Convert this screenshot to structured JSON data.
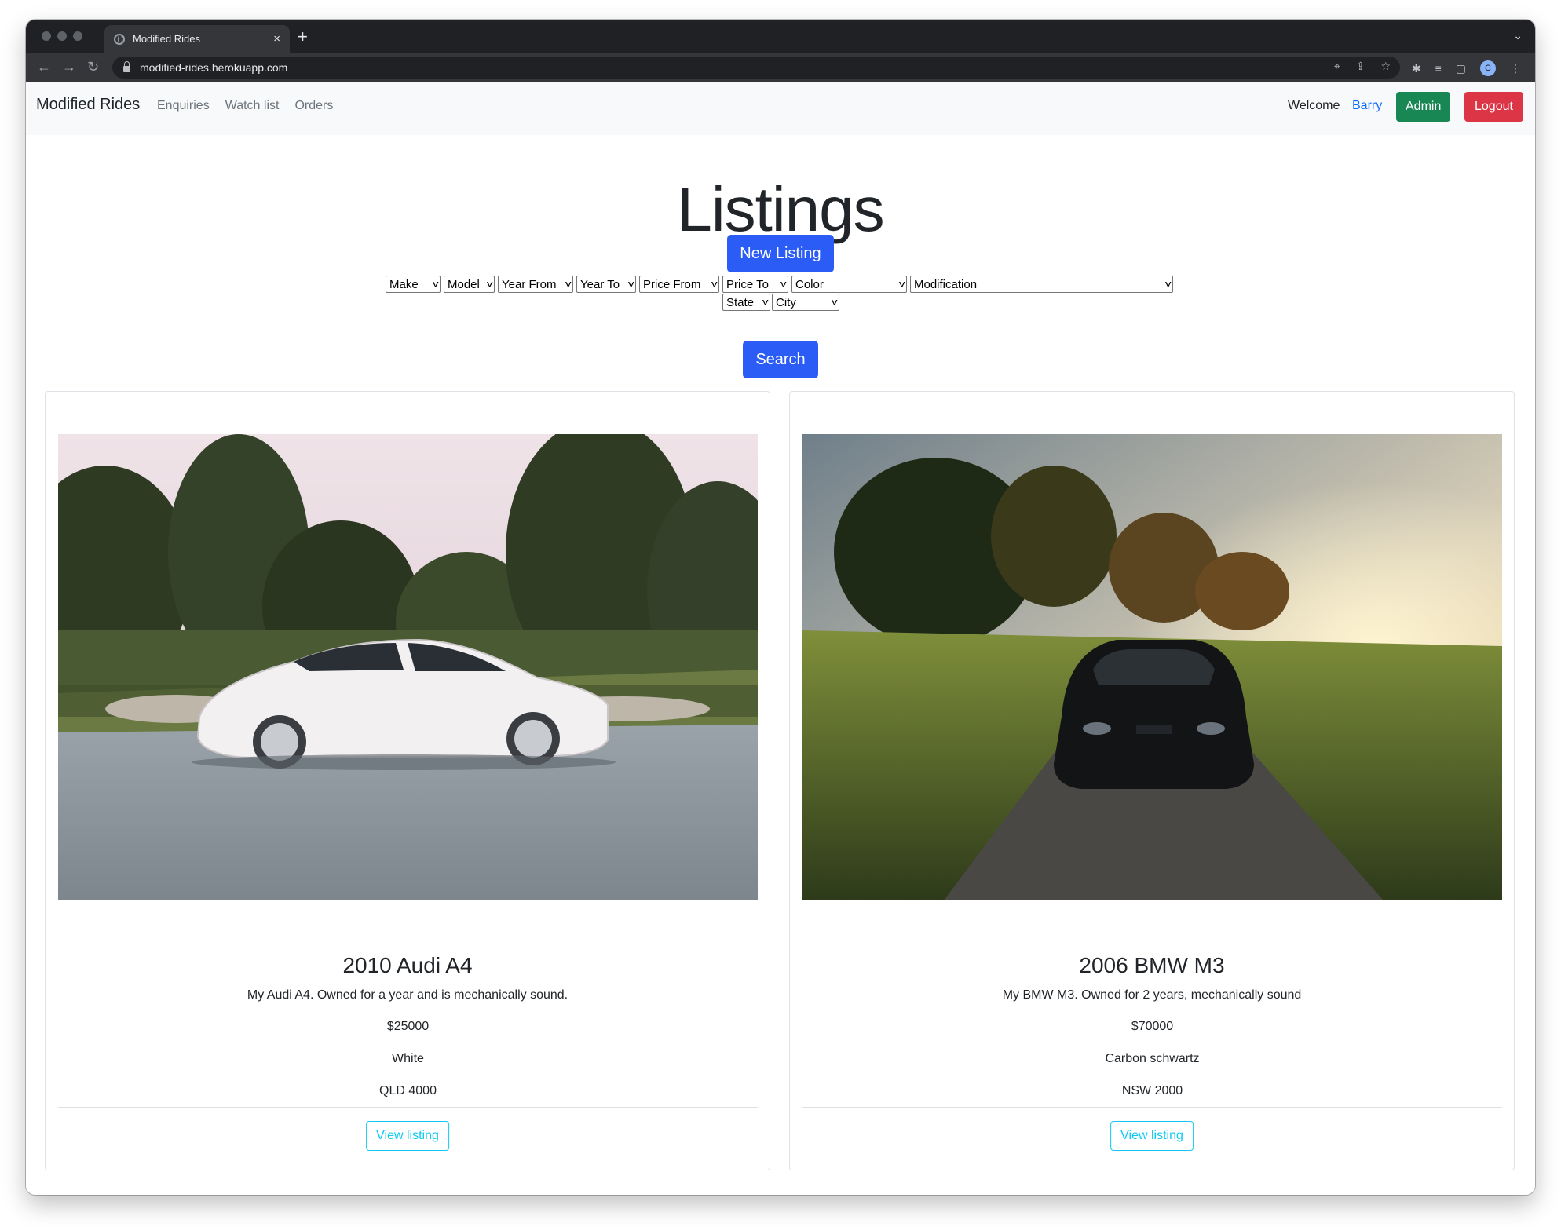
{
  "browser": {
    "tab_title": "Modified Rides",
    "tab_close": "×",
    "new_tab": "+",
    "url": "modified-rides.herokuapp.com",
    "profile_initial": "C"
  },
  "navbar": {
    "brand": "Modified Rides",
    "links": [
      "Enquiries",
      "Watch list",
      "Orders"
    ],
    "welcome": "Welcome",
    "user": "Barry",
    "admin": "Admin",
    "logout": "Logout"
  },
  "main": {
    "heading": "Listings",
    "new_listing": "New Listing",
    "search": "Search"
  },
  "filters": {
    "make": "Make",
    "model": "Model",
    "year_from": "Year From",
    "year_to": "Year To",
    "price_from": "Price From",
    "price_to": "Price To",
    "color": "Color",
    "modification": "Modification",
    "state": "State",
    "city": "City"
  },
  "listings": [
    {
      "title": "2010 Audi A4",
      "description": "My Audi A4. Owned for a year and is mechanically sound.",
      "price": "$25000",
      "color": "White",
      "location": "QLD 4000",
      "button": "View listing"
    },
    {
      "title": "2006 BMW M3",
      "description": "My BMW M3. Owned for 2 years, mechanically sound",
      "price": "$70000",
      "color": "Carbon schwartz",
      "location": "NSW 2000",
      "button": "View listing"
    }
  ],
  "colors": {
    "primary": "#2b5cf6",
    "admin": "#198754",
    "logout": "#dc3545",
    "info": "#0dcaf0",
    "link": "#0d6efd"
  },
  "icons": [
    "back-arrow-icon",
    "forward-arrow-icon",
    "reload-icon",
    "lock-icon",
    "location-icon",
    "share-icon",
    "bookmark-star-icon",
    "extensions-icon",
    "reading-list-icon",
    "side-panel-icon",
    "menu-dots-icon",
    "chevron-down-icon"
  ]
}
